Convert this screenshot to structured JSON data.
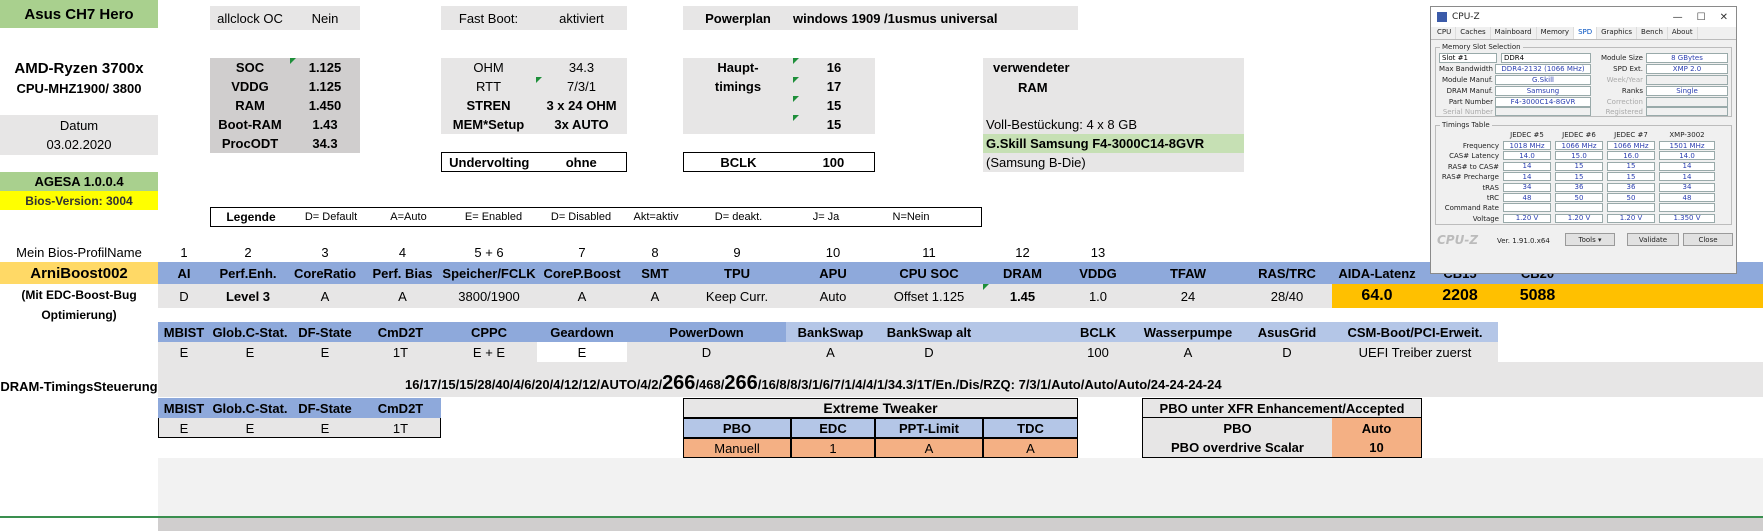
{
  "header": {
    "board": "Asus CH7 Hero",
    "allclock_label": "allclock OC",
    "allclock_value": "Nein",
    "fastboot_label": "Fast Boot:",
    "fastboot_value": "aktiviert",
    "powerplan_label": "Powerplan",
    "powerplan_value": "windows 1909 /1usmus universal"
  },
  "cpu": {
    "name": "AMD-Ryzen 3700x",
    "mhz": "CPU-MHZ1900/ 3800",
    "date_label": "Datum",
    "date_value": "03.02.2020"
  },
  "voltages": [
    {
      "label": "SOC",
      "value": "1.125"
    },
    {
      "label": "VDDG",
      "value": "1.125"
    },
    {
      "label": "RAM",
      "value": "1.450"
    },
    {
      "label": "Boot-RAM",
      "value": "1.43"
    },
    {
      "label": "ProcODT",
      "value": "34.3"
    }
  ],
  "ohm": [
    {
      "label": "OHM",
      "value": "34.3"
    },
    {
      "label": "RTT",
      "value": "7/3/1"
    },
    {
      "label": "STREN",
      "value": "3 x 24 OHM"
    },
    {
      "label": "MEM*Setup",
      "value": "3x AUTO"
    }
  ],
  "haupt": {
    "label1": "Haupt-",
    "label2": "timings",
    "values": [
      "16",
      "17",
      "15",
      "15"
    ]
  },
  "ram_info": {
    "label1": "verwendeter",
    "label2": "RAM",
    "population": "Voll-Bestückung: 4 x 8 GB",
    "model": "G.Skill Samsung F4-3000C14-8GVR",
    "die": "(Samsung B-Die)"
  },
  "undervolting": {
    "label": "Undervolting",
    "value": "ohne"
  },
  "bclk": {
    "label": "BCLK",
    "value": "100"
  },
  "agesa": "AGESA 1.0.0.4",
  "bios": "Bios-Version: 3004",
  "legend": {
    "title": "Legende",
    "items": [
      "D= Default",
      "A=Auto",
      "E= Enabled",
      "D= Disabled",
      "Akt=aktiv",
      "D= deakt.",
      "J= Ja",
      "N=Nein"
    ]
  },
  "profile": {
    "label": "Mein Bios-ProfilName",
    "numbers": [
      "1",
      "2",
      "3",
      "4",
      "5 + 6",
      "7",
      "8",
      "9",
      "10",
      "11",
      "12",
      "13"
    ],
    "name": "ArniBoost002",
    "note1": "(Mit EDC-Boost-Bug",
    "note2": "Optimierung)",
    "headers": [
      "AI",
      "Perf.Enh.",
      "CoreRatio",
      "Perf. Bias",
      "Speicher/FCLK",
      "CoreP.Boost",
      "SMT",
      "TPU",
      "APU",
      "CPU SOC",
      "DRAM",
      "VDDG",
      "TFAW",
      "RAS/TRC",
      "AIDA-Latenz",
      "CB15",
      "CB20"
    ],
    "values": [
      "D",
      "Level 3",
      "A",
      "A",
      "3800/1900",
      "A",
      "A",
      "Keep Curr.",
      "Auto",
      "Offset 1.125",
      "1.45",
      "1.0",
      "24",
      "28/40",
      "64.0",
      "2208",
      "5088"
    ]
  },
  "row2": {
    "headers": [
      "MBIST",
      "Glob.C-Stat.",
      "DF-State",
      "CmD2T",
      "CPPC",
      "Geardown",
      "PowerDown",
      "BankSwap",
      "BankSwap alt",
      "BCLK",
      "Wasserpumpe",
      "AsusGrid",
      "CSM-Boot/PCI-Erweit."
    ],
    "values": [
      "E",
      "E",
      "E",
      "1T",
      "E + E",
      "E",
      "D",
      "A",
      "D",
      "100",
      "A",
      "D",
      "UEFI Treiber zuerst"
    ]
  },
  "timings": {
    "label": "DRAM-TimingsSteuerung",
    "pre": "16/17/15/15/28/40/4/6/20/4/12/12/AUTO/4/2/",
    "big1": "266",
    "mid": "/468/",
    "big2": "266",
    "post": "/16/8/8/3/1/6/7/1/4/4/1/34.3/1T/En./Dis/RZQ: 7/3/1/Auto/Auto/Auto/24-24-24-24"
  },
  "row3": {
    "headers": [
      "MBIST",
      "Glob.C-Stat.",
      "DF-State",
      "CmD2T"
    ],
    "values": [
      "E",
      "E",
      "E",
      "1T"
    ]
  },
  "extreme": {
    "title": "Extreme Tweaker",
    "headers": [
      "PBO",
      "EDC",
      "PPT-Limit",
      "TDC"
    ],
    "values": [
      "Manuell",
      "1",
      "A",
      "A"
    ]
  },
  "pbo_xfr": {
    "title": "PBO unter XFR Enhancement/Accepted",
    "rows": [
      {
        "label": "PBO",
        "value": "Auto"
      },
      {
        "label": "PBO overdrive Scalar",
        "value": "10"
      }
    ]
  },
  "cpuz": {
    "title": "CPU-Z",
    "tabs": [
      "CPU",
      "Caches",
      "Mainboard",
      "Memory",
      "SPD",
      "Graphics",
      "Bench",
      "About"
    ],
    "slot_group": "Memory Slot Selection",
    "slot": "Slot #1",
    "ddr": "DDR4",
    "module_size_label": "Module Size",
    "module_size": "8 GBytes",
    "max_bw_label": "Max Bandwidth",
    "max_bw": "DDR4-2132 (1066 MHz)",
    "spd_ext_label": "SPD Ext.",
    "spd_ext": "XMP 2.0",
    "manuf_label": "Module Manuf.",
    "manuf": "G.Skill",
    "week_label": "Week/Year",
    "dram_label": "DRAM Manuf.",
    "dram": "Samsung",
    "ranks_label": "Ranks",
    "ranks": "Single",
    "part_label": "Part Number",
    "part": "F4-3000C14-8GVR",
    "corr_label": "Correction",
    "serial_label": "Serial Number",
    "reg_label": "Registered",
    "timings_group": "Timings Table",
    "cols": [
      "JEDEC #5",
      "JEDEC #6",
      "JEDEC #7",
      "XMP-3002"
    ],
    "rows": [
      {
        "label": "Frequency",
        "vals": [
          "1018 MHz",
          "1066 MHz",
          "1066 MHz",
          "1501 MHz"
        ]
      },
      {
        "label": "CAS# Latency",
        "vals": [
          "14.0",
          "15.0",
          "16.0",
          "14.0"
        ]
      },
      {
        "label": "RAS# to CAS#",
        "vals": [
          "14",
          "15",
          "15",
          "14"
        ]
      },
      {
        "label": "RAS# Precharge",
        "vals": [
          "14",
          "15",
          "15",
          "14"
        ]
      },
      {
        "label": "tRAS",
        "vals": [
          "34",
          "36",
          "36",
          "34"
        ]
      },
      {
        "label": "tRC",
        "vals": [
          "48",
          "50",
          "50",
          "48"
        ]
      },
      {
        "label": "Command Rate",
        "vals": [
          "",
          "",
          "",
          ""
        ]
      },
      {
        "label": "Voltage",
        "vals": [
          "1.20 V",
          "1.20 V",
          "1.20 V",
          "1.350 V"
        ]
      }
    ],
    "logo": "CPU-Z",
    "version": "Ver. 1.91.0.x64",
    "tools": "Tools",
    "validate": "Validate",
    "close": "Close"
  }
}
